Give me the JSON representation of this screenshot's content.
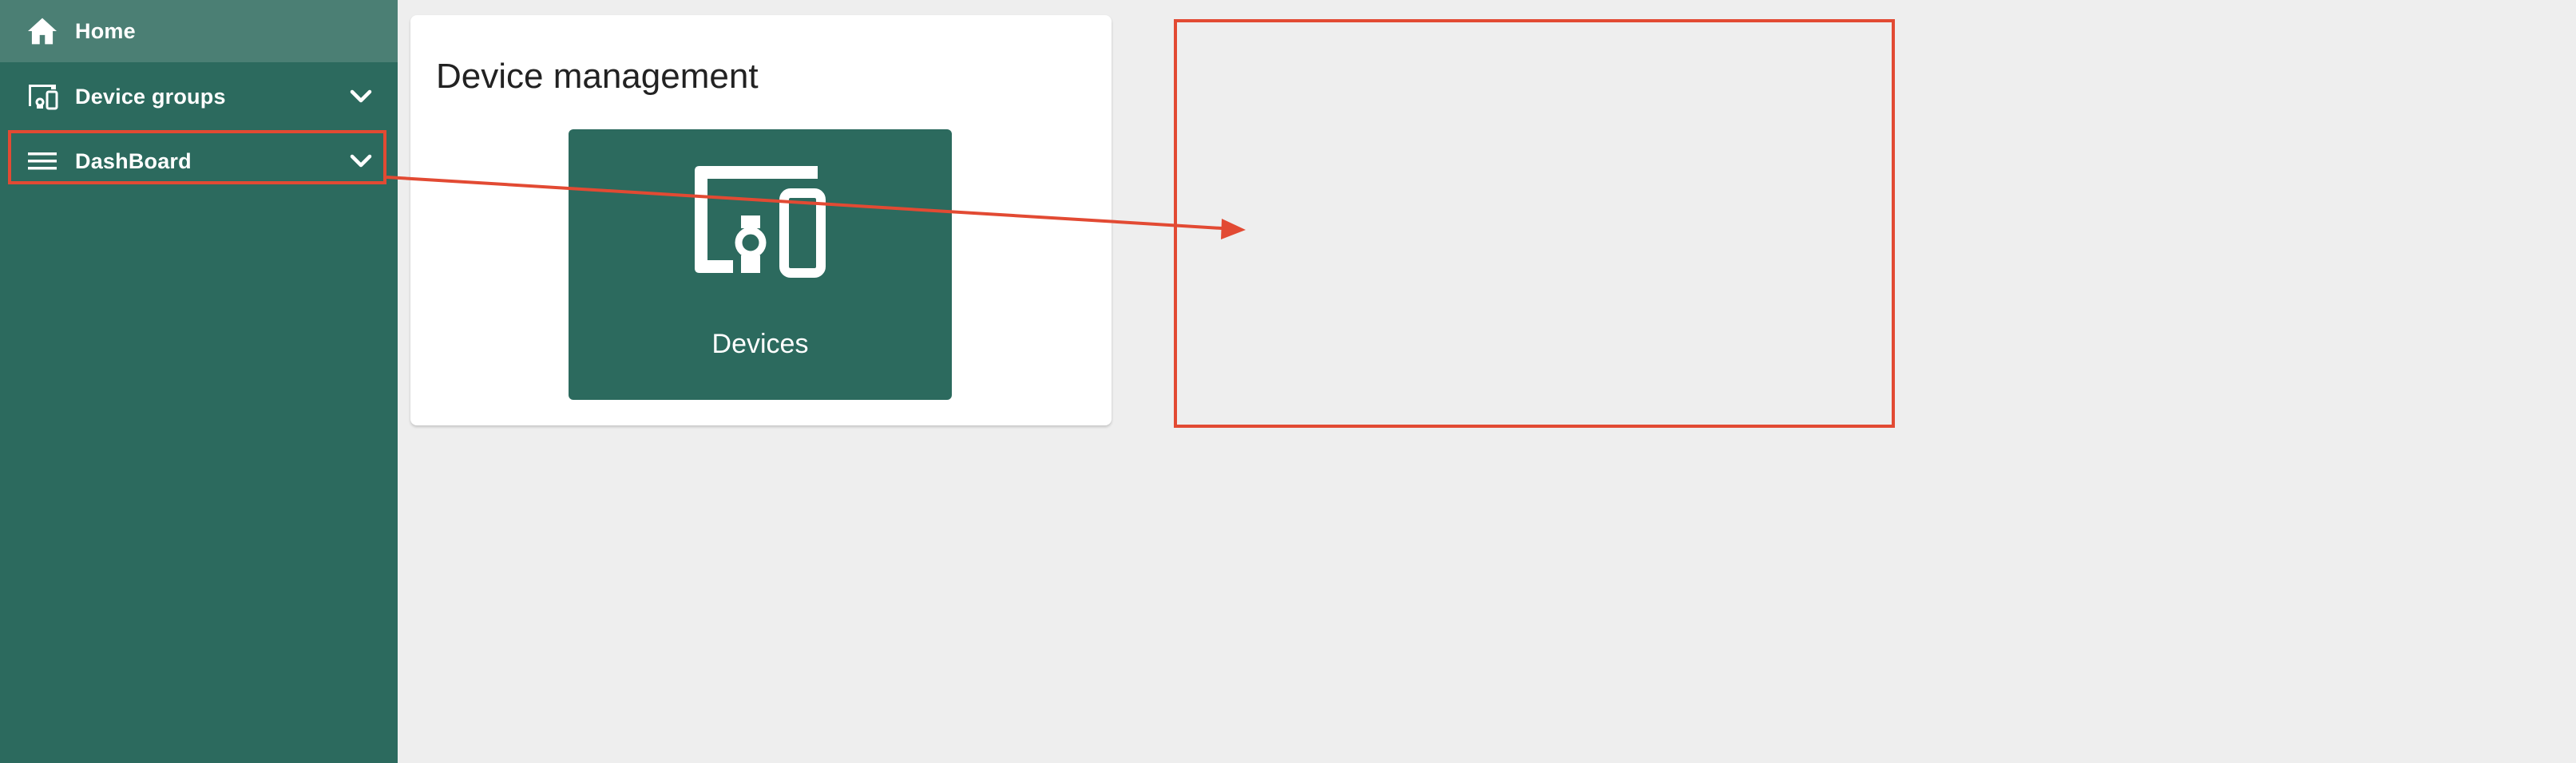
{
  "sidebar": {
    "items": [
      {
        "label": "Home",
        "icon": "home-icon",
        "active": true
      },
      {
        "label": "Device groups",
        "icon": "device-groups-icon",
        "expandable": true
      },
      {
        "label": "DashBoard",
        "icon": "menu-icon",
        "expandable": true
      }
    ]
  },
  "main": {
    "card_title": "Device management",
    "tiles": [
      {
        "label": "Devices",
        "icon": "devices-icon"
      }
    ]
  },
  "colors": {
    "sidebar_bg": "#2c6a5e",
    "sidebar_active": "#4b7f74",
    "page_bg": "#eeeeee",
    "annotation": "#e24a33"
  }
}
